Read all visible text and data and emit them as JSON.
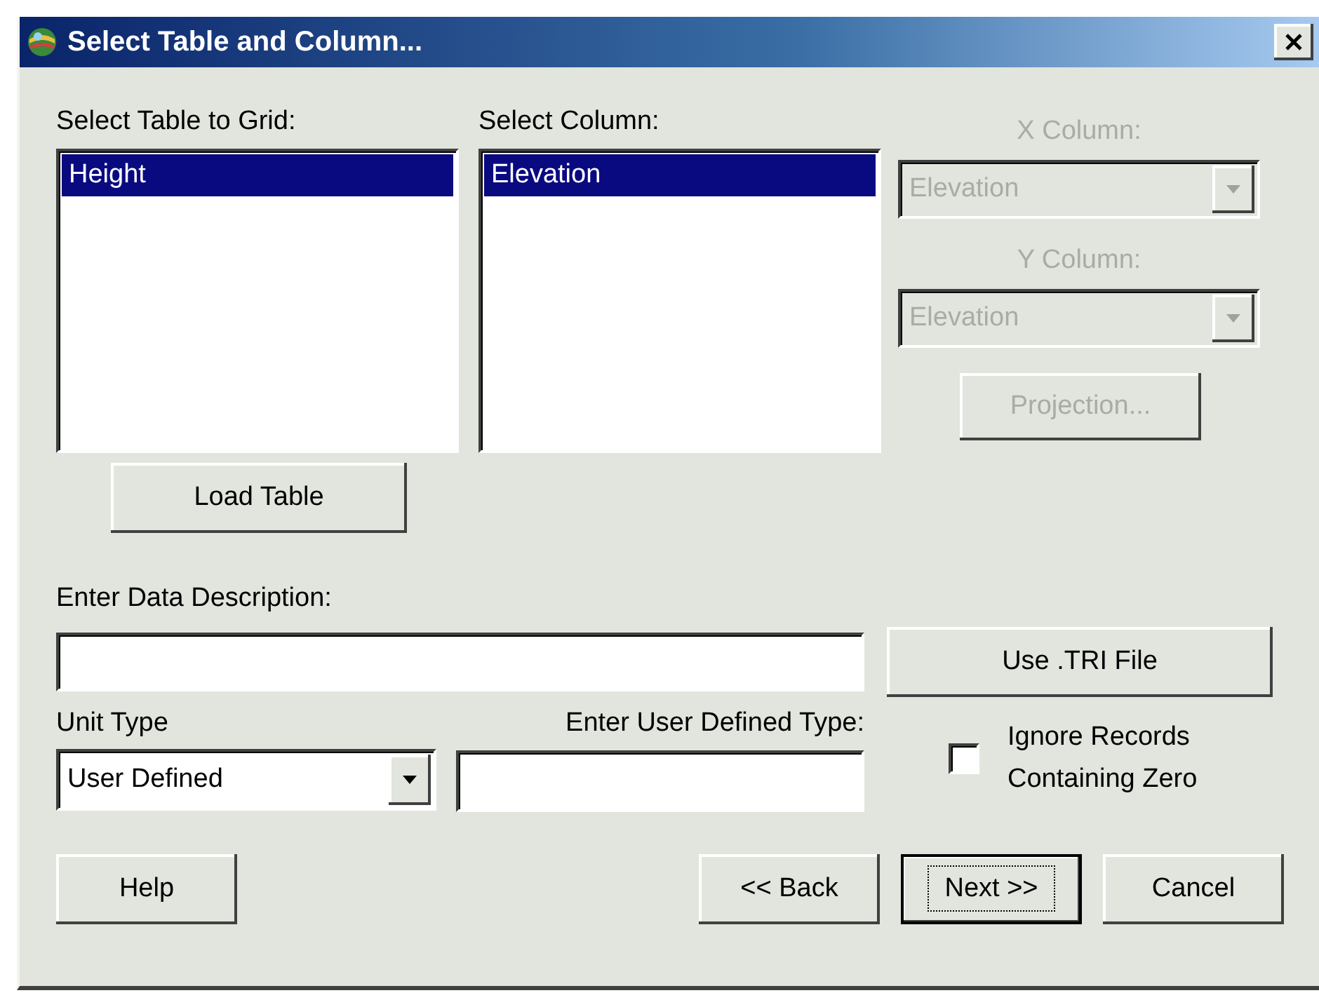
{
  "window": {
    "title": "Select Table and Column..."
  },
  "table_list": {
    "label": "Select Table to Grid:",
    "items": [
      {
        "text": "Height",
        "selected": true
      }
    ]
  },
  "column_list": {
    "label": "Select Column:",
    "items": [
      {
        "text": "Elevation",
        "selected": true
      }
    ]
  },
  "x_column": {
    "label": "X Column:",
    "value": "Elevation",
    "disabled": true
  },
  "y_column": {
    "label": "Y Column:",
    "value": "Elevation",
    "disabled": true
  },
  "projection_button": {
    "label": "Projection...",
    "disabled": true
  },
  "load_table_button": {
    "label": "Load Table"
  },
  "description": {
    "label": "Enter Data Description:"
  },
  "use_tri_button": {
    "label": "Use .TRI File"
  },
  "unit_type": {
    "label": "Unit Type",
    "value": "User Defined"
  },
  "user_defined_type": {
    "label": "Enter User Defined Type:"
  },
  "ignore_zero": {
    "label": "Ignore Records Containing Zero",
    "checked": false
  },
  "buttons": [
    {
      "label": "Help",
      "default": false
    },
    {
      "label": "<< Back",
      "default": false
    },
    {
      "label": "Next >>",
      "default": true
    },
    {
      "label": "Cancel",
      "default": false
    }
  ]
}
